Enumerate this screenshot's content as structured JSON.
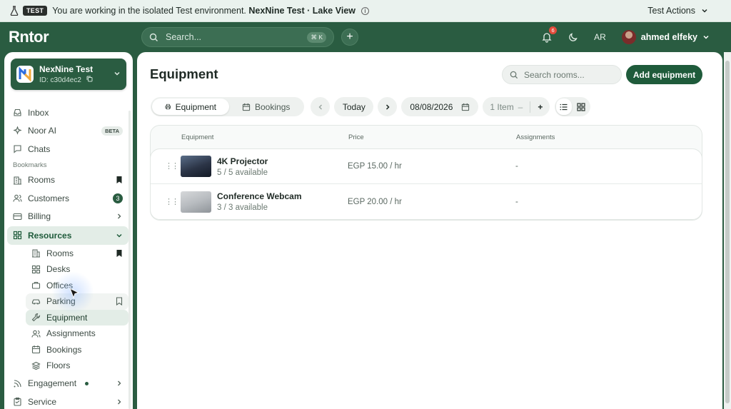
{
  "banner": {
    "badge": "TEST",
    "message_prefix": "You are working in the isolated Test environment.",
    "message_env": "NexNine Test · Lake View",
    "actions_label": "Test Actions"
  },
  "topnav": {
    "logo": "Rntor",
    "search_placeholder": "Search...",
    "search_shortcut": "⌘ K",
    "notification_count": "6",
    "language": "AR",
    "user_name": "ahmed elfeky"
  },
  "org": {
    "name": "NexNine Test",
    "id": "ID: c30d4ec2"
  },
  "sidebar": {
    "inbox": "Inbox",
    "noor_ai": "Noor AI",
    "beta": "BETA",
    "chats": "Chats",
    "bookmarks_label": "Bookmarks",
    "rooms_bookmark": "Rooms",
    "customers": "Customers",
    "customers_count": "3",
    "billing": "Billing",
    "resources": "Resources",
    "resources_children": {
      "rooms": "Rooms",
      "desks": "Desks",
      "offices": "Offices",
      "parking": "Parking",
      "equipment": "Equipment",
      "assignments": "Assignments",
      "bookings": "Bookings",
      "floors": "Floors"
    },
    "engagement": "Engagement",
    "service": "Service"
  },
  "main": {
    "title": "Equipment",
    "search_placeholder": "Search rooms...",
    "add_button": "Add equipment",
    "tabs": {
      "equipment": "Equipment",
      "bookings": "Bookings"
    },
    "today": "Today",
    "date": "08/08/2026",
    "item_count": "1 Item",
    "stepper_minus": "–",
    "stepper_plus": "+",
    "table": {
      "headers": {
        "equipment": "Equipment",
        "price": "Price",
        "assignments": "Assignments"
      },
      "rows": [
        {
          "name": "4K Projector",
          "availability": "5 / 5 available",
          "price": "EGP 15.00 / hr",
          "assignments": "-"
        },
        {
          "name": "Conference Webcam",
          "availability": "3 / 3 available",
          "price": "EGP 20.00 / hr",
          "assignments": "-"
        }
      ]
    }
  },
  "colors": {
    "brand": "#2a5c41",
    "accent_button": "#1f5b3b",
    "badge_red": "#e24b3b"
  }
}
